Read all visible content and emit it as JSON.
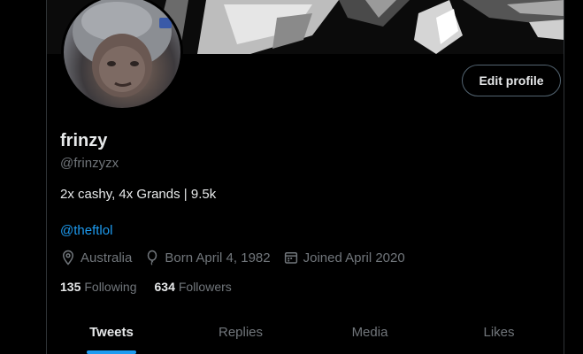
{
  "profile": {
    "name": "frinzy",
    "handle": "@frinzyzx",
    "bio": "2x cashy, 4x Grands | 9.5k",
    "mention": "@theftlol",
    "location": "Australia",
    "birthday": "Born April 4, 1982",
    "joined": "Joined April 2020",
    "following_count": "135",
    "following_label": "Following",
    "followers_count": "634",
    "followers_label": "Followers"
  },
  "actions": {
    "edit_profile": "Edit profile"
  },
  "tabs": [
    {
      "label": "Tweets",
      "active": true
    },
    {
      "label": "Replies",
      "active": false
    },
    {
      "label": "Media",
      "active": false
    },
    {
      "label": "Likes",
      "active": false
    }
  ],
  "colors": {
    "background": "#000000",
    "text": "#e7e9ea",
    "muted": "#71767b",
    "accent": "#1d9bf0",
    "border": "#2f3336"
  },
  "icons": {
    "location": "map-pin-icon",
    "birthday": "balloon-icon",
    "joined": "calendar-icon"
  }
}
